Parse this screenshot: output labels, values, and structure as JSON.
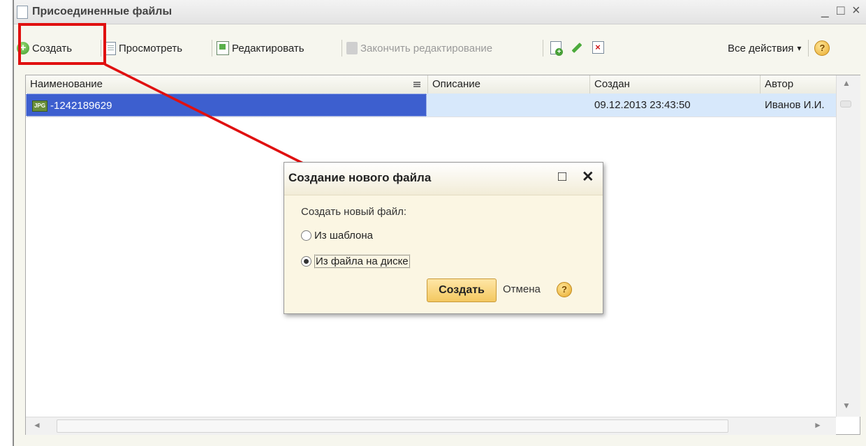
{
  "window": {
    "title": "Присоединенные файлы",
    "controls": {
      "minimize": "_",
      "maximize": "□",
      "close": "×"
    }
  },
  "toolbar": {
    "create_label": "Создать",
    "view_label": "Просмотреть",
    "edit_label": "Редактировать",
    "finish_edit_label": "Закончить редактирование",
    "all_actions_label": "Все действия",
    "all_actions_arrow": "▾",
    "help_label": "?",
    "icons": [
      "plus-circle-icon",
      "document-icon",
      "edit-document-icon",
      "lock-icon",
      "document-add-icon",
      "pencil-icon",
      "delete-icon",
      "help-icon"
    ],
    "highlight_color": "#e01010"
  },
  "table": {
    "columns": [
      "Наименование",
      "Описание",
      "Создан",
      "Автор"
    ],
    "rows": [
      {
        "icon_label": "JPG",
        "name": "-1242189629",
        "description": "",
        "created": "09.12.2013 23:43:50",
        "author": "Иванов И.И."
      }
    ],
    "selected_color": "#3d5fcf",
    "row_highlight_color": "#d7e8fb"
  },
  "dialog": {
    "title": "Создание нового файла",
    "maximize": "□",
    "close": "✕",
    "prompt": "Создать новый файл:",
    "options": [
      {
        "label": "Из шаблона",
        "selected": false
      },
      {
        "label": "Из файла на диске",
        "selected": true
      }
    ],
    "create_label": "Создать",
    "cancel_label": "Отмена",
    "help_label": "?"
  },
  "scroll": {
    "up": "▲",
    "down": "▼",
    "left": "◄",
    "right": "►"
  }
}
